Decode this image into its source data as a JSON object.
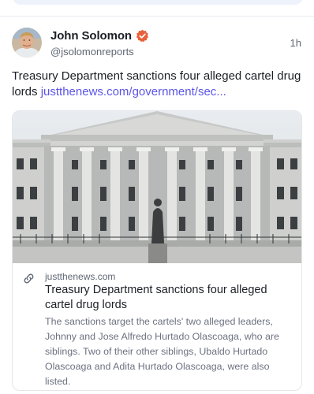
{
  "post": {
    "author_name": "John Solomon",
    "author_handle": "@jsolomonreports",
    "timestamp": "1h",
    "verified": true,
    "text": "Treasury Department sanctions four alleged cartel drug lords ",
    "link_text": "justthenews.com/government/sec...",
    "link_color": "#5b55e8",
    "avatar_icon": "avatar-photo"
  },
  "link_card": {
    "domain": "justthenews.com",
    "title": "Treasury Department sanctions four alleged cartel drug lords",
    "description": "The sanctions target the cartels' two alleged leaders, Johnny and Jose Alfredo Hurtado Olascoaga, who are siblings. Two of their other siblings, Ubaldo Hurtado Olascoaga and Adita Hurtado Olascoaga, were also listed.",
    "link_icon": "link-icon",
    "image_subject": "treasury-building-photo"
  },
  "colors": {
    "verified_badge": "#e8613c",
    "card_border": "#e4e6ea",
    "muted_text": "#5f6673"
  }
}
